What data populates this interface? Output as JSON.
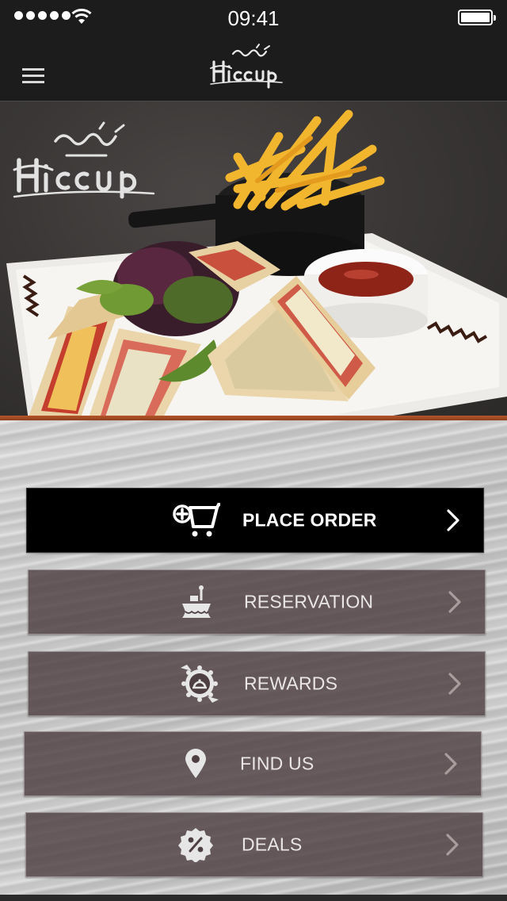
{
  "status_bar": {
    "time": "09:41",
    "signal_icon": "signal-dots-icon",
    "wifi_icon": "wifi-icon",
    "battery_icon": "battery-icon"
  },
  "nav_bar": {
    "menu_icon": "hamburger-menu-icon",
    "logo_icon": "hiccup-logo-icon"
  },
  "hero": {
    "logo_icon": "hiccup-logo-icon",
    "image": "club-sandwich-with-fries-photo",
    "accent_color": "#b5562a"
  },
  "menu": {
    "items": [
      {
        "label": "PLACE ORDER",
        "icon": "shopping-cart-add-icon"
      },
      {
        "label": "RESERVATION",
        "icon": "reserved-table-icon"
      },
      {
        "label": "REWARDS",
        "icon": "reward-badge-icon"
      },
      {
        "label": "FIND US",
        "icon": "location-pin-icon"
      },
      {
        "label": "DEALS",
        "icon": "percent-badge-icon"
      }
    ]
  },
  "colors": {
    "primary_button": "#000000",
    "secondary_button": "#4e4042",
    "header_background": "#1c1c1c"
  }
}
